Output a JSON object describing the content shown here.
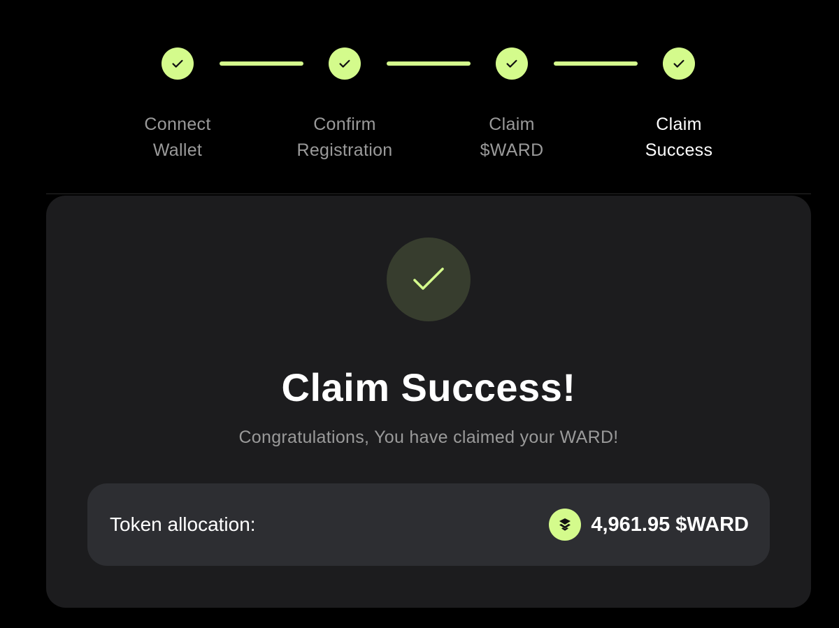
{
  "stepper": {
    "steps": [
      {
        "label": "Connect\nWallet",
        "state": "complete"
      },
      {
        "label": "Confirm\nRegistration",
        "state": "complete"
      },
      {
        "label": "Claim\n$WARD",
        "state": "complete"
      },
      {
        "label": "Claim\nSuccess",
        "state": "active"
      }
    ]
  },
  "card": {
    "title": "Claim Success!",
    "subtitle": "Congratulations, You have claimed your WARD!",
    "allocation": {
      "label": "Token allocation:",
      "value": "4,961.95 $WARD",
      "icon": "ward-token-icon"
    }
  },
  "colors": {
    "accent": "#d4fb8c",
    "background": "#000000",
    "card": "#1c1c1e",
    "allocation_panel": "#2d2e32",
    "muted_text": "#9a9a9a"
  }
}
